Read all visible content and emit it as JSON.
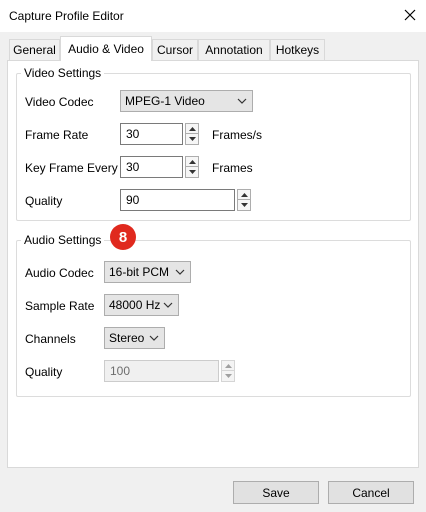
{
  "window": {
    "title": "Capture Profile Editor"
  },
  "tabs": [
    {
      "label": "General"
    },
    {
      "label": "Audio & Video"
    },
    {
      "label": "Cursor"
    },
    {
      "label": "Annotation"
    },
    {
      "label": "Hotkeys"
    }
  ],
  "video": {
    "group_title": "Video Settings",
    "codec_label": "Video Codec",
    "codec_value": "MPEG-1 Video",
    "frame_rate_label": "Frame Rate",
    "frame_rate_value": "30",
    "frame_rate_unit": "Frames/s",
    "key_frame_label": "Key Frame Every",
    "key_frame_value": "30",
    "key_frame_unit": "Frames",
    "quality_label": "Quality",
    "quality_value": "90"
  },
  "audio": {
    "group_title": "Audio Settings",
    "step_badge": "8",
    "codec_label": "Audio Codec",
    "codec_value": "16-bit PCM",
    "sample_rate_label": "Sample Rate",
    "sample_rate_value": "48000 Hz",
    "channels_label": "Channels",
    "channels_value": "Stereo",
    "quality_label": "Quality",
    "quality_value": "100"
  },
  "buttons": {
    "save": "Save",
    "cancel": "Cancel"
  },
  "colors": {
    "badge": "#e0291e",
    "panel": "#ffffff",
    "dialog": "#f0f0f0"
  }
}
